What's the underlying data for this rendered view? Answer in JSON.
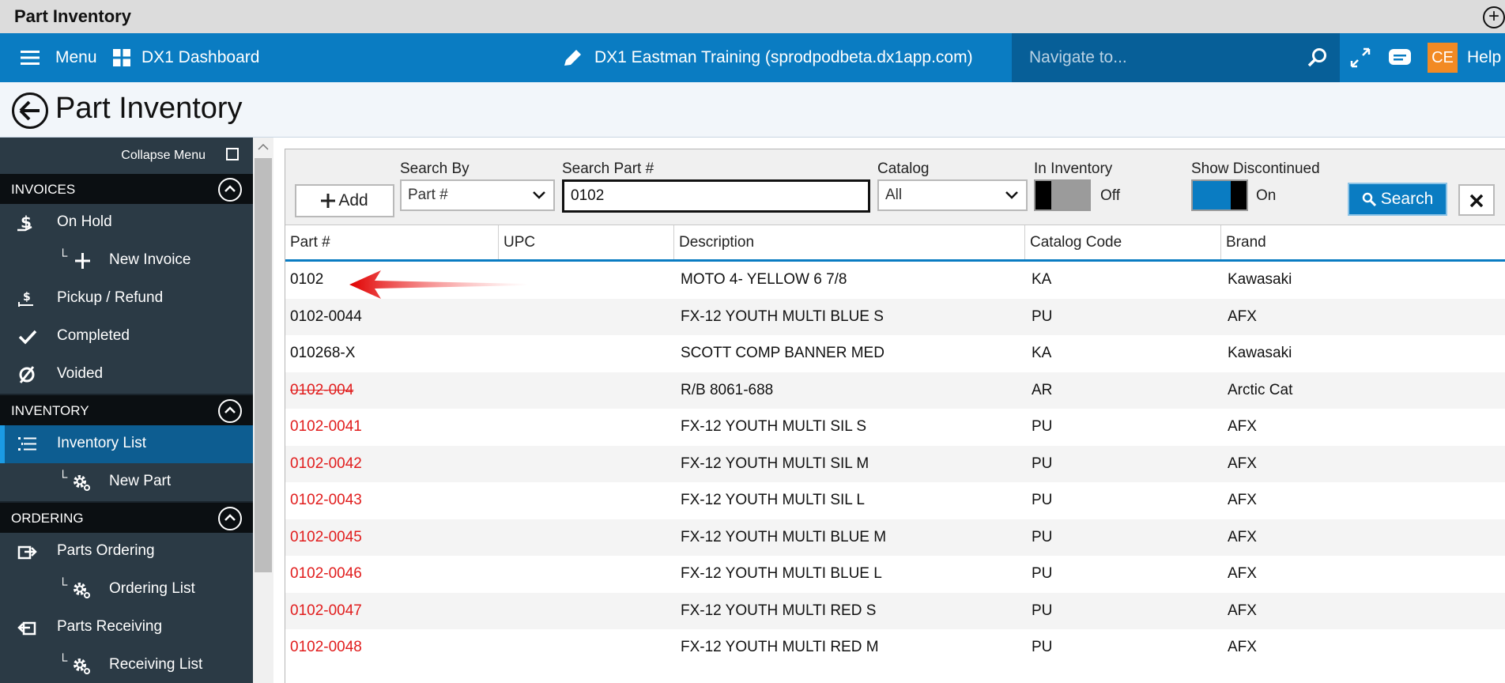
{
  "window": {
    "title": "Part Inventory",
    "new_tab_icon": "plus-circle-icon"
  },
  "navbar": {
    "menu_label": "Menu",
    "dashboard_label": "DX1 Dashboard",
    "env_label": "DX1 Eastman Training (sprodpodbeta.dx1app.com)",
    "navigate_placeholder": "Navigate to...",
    "avatar_initials": "CE",
    "help_label": "Help"
  },
  "page": {
    "title": "Part Inventory"
  },
  "sidebar": {
    "collapse_label": "Collapse Menu",
    "sections": {
      "invoices": "INVOICES",
      "inventory": "INVENTORY",
      "ordering": "ORDERING"
    },
    "items": {
      "on_hold": "On Hold",
      "new_invoice": "New Invoice",
      "pickup_refund": "Pickup / Refund",
      "completed": "Completed",
      "voided": "Voided",
      "inventory_list": "Inventory List",
      "new_part": "New Part",
      "parts_ordering": "Parts Ordering",
      "ordering_list": "Ordering List",
      "parts_receiving": "Parts Receiving",
      "receiving_list": "Receiving List"
    }
  },
  "toolbar": {
    "add_label": "Add",
    "search_by_label": "Search By",
    "search_by_value": "Part #",
    "search_part_label": "Search Part #",
    "search_part_value": "0102",
    "catalog_label": "Catalog",
    "catalog_value": "All",
    "in_inventory_label": "In Inventory",
    "in_inventory_state": "Off",
    "show_discontinued_label": "Show Discontinued",
    "show_discontinued_state": "On",
    "search_label": "Search"
  },
  "table": {
    "columns": [
      "Part #",
      "UPC",
      "Description",
      "Catalog Code",
      "Brand"
    ],
    "rows": [
      {
        "part": "0102",
        "upc": "",
        "description": "MOTO 4- YELLOW 6 7/8",
        "catalog": "KA",
        "brand": "Kawasaki"
      },
      {
        "part": "0102-0044",
        "upc": "",
        "description": "FX-12 YOUTH MULTI BLUE S",
        "catalog": "PU",
        "brand": "AFX"
      },
      {
        "part": "010268-X",
        "upc": "",
        "description": "SCOTT COMP BANNER MED",
        "catalog": "KA",
        "brand": "Kawasaki"
      },
      {
        "part": "0102-004",
        "upc": "",
        "description": "R/B 8061-688",
        "catalog": "AR",
        "brand": "Arctic Cat"
      },
      {
        "part": "0102-0041",
        "upc": "",
        "description": "FX-12 YOUTH MULTI SIL S",
        "catalog": "PU",
        "brand": "AFX"
      },
      {
        "part": "0102-0042",
        "upc": "",
        "description": "FX-12 YOUTH MULTI SIL M",
        "catalog": "PU",
        "brand": "AFX"
      },
      {
        "part": "0102-0043",
        "upc": "",
        "description": "FX-12 YOUTH MULTI SIL L",
        "catalog": "PU",
        "brand": "AFX"
      },
      {
        "part": "0102-0045",
        "upc": "",
        "description": "FX-12 YOUTH MULTI BLUE M",
        "catalog": "PU",
        "brand": "AFX"
      },
      {
        "part": "0102-0046",
        "upc": "",
        "description": "FX-12 YOUTH MULTI BLUE L",
        "catalog": "PU",
        "brand": "AFX"
      },
      {
        "part": "0102-0047",
        "upc": "",
        "description": "FX-12 YOUTH MULTI RED S",
        "catalog": "PU",
        "brand": "AFX"
      },
      {
        "part": "0102-0048",
        "upc": "",
        "description": "FX-12 YOUTH MULTI RED M",
        "catalog": "PU",
        "brand": "AFX"
      }
    ]
  },
  "colors": {
    "brand_blue": "#0a7cc2",
    "sidebar_bg": "#2b3a45",
    "discontinued_red": "#e11d1d",
    "avatar_orange": "#f28a24"
  }
}
